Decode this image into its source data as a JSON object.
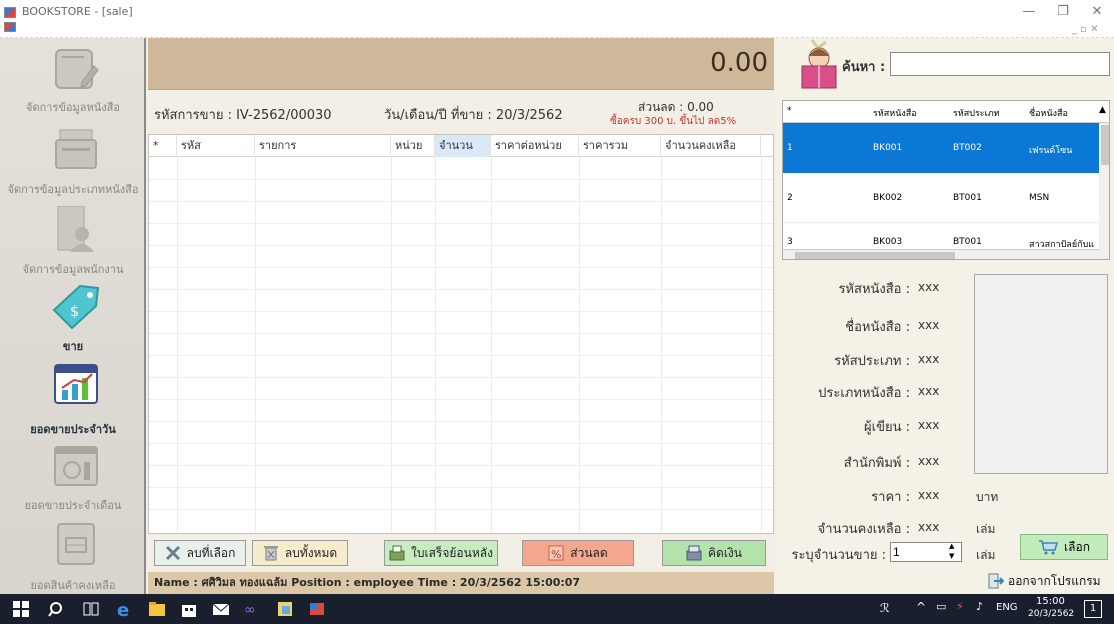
{
  "window": {
    "title": "BOOKSTORE - [sale]",
    "controls": [
      "—",
      "❐",
      "✕"
    ],
    "mdi_controls": "_ ▫ ✕"
  },
  "sidebar": {
    "items": [
      {
        "label": "จัดการข้อมูลหนังสือ",
        "icon": "book-edit-icon",
        "active": false
      },
      {
        "label": "จัดการข้อมูลประเภทหนังสือ",
        "icon": "book-stack-icon",
        "active": false
      },
      {
        "label": "จัดการข้อมูลพนักงาน",
        "icon": "employee-icon",
        "active": false
      },
      {
        "label": "ขาย",
        "icon": "price-tag-icon",
        "active": true
      },
      {
        "label": "ยอดขายประจำวัน",
        "icon": "daily-chart-icon",
        "active": true
      },
      {
        "label": "ยอดขายประจำเดือน",
        "icon": "monthly-money-icon",
        "active": false
      },
      {
        "label": "ยอดสินค้าคงเหลือ",
        "icon": "inventory-icon",
        "active": false
      }
    ]
  },
  "sale": {
    "total": "0.00",
    "sale_id_label": "รหัสการขาย : IV-2562/00030",
    "date_label": "วัน/เดือน/ปี ที่ขาย : 20/3/2562",
    "discount_label": "ส่วนลด : 0.00",
    "discount_note": "ซื้อครบ 300 บ. ขึ้นไป ลด5%",
    "columns": [
      "*",
      "รหัส",
      "รายการ",
      "หน่วย",
      "จำนวน",
      "ราคาต่อหน่วย",
      "ราคารวม",
      "จำนวนคงเหลือ"
    ]
  },
  "buttons": {
    "delete_selected": "ลบที่เลือก",
    "delete_all": "ลบทั้งหมด",
    "receipt_history": "ใบเสร็จย้อนหลัง",
    "discount": "ส่วนลด",
    "checkout": "คิดเงิน"
  },
  "status": {
    "text": "Name : ศศิวิมล ทองแฉล้ม Position : employee Time : 20/3/2562 15:00:07"
  },
  "search": {
    "label": "ค้นหา :",
    "value": ""
  },
  "book_grid": {
    "columns": [
      "*",
      "รหัสหนังสือ",
      "รหัสประเภท",
      "ชื่อหนังสือ"
    ],
    "rows": [
      {
        "n": "1",
        "book_id": "BK001",
        "type_id": "BT002",
        "name": "เฟรนด์โซน",
        "selected": true
      },
      {
        "n": "2",
        "book_id": "BK002",
        "type_id": "BT001",
        "name": "MSN",
        "selected": false
      },
      {
        "n": "3",
        "book_id": "BK003",
        "type_id": "BT001",
        "name": "สาวสกาปัลย์กับแ",
        "selected": false
      }
    ]
  },
  "details": {
    "book_id_label": "รหัสหนังสือ :",
    "book_id": "xxx",
    "book_name_label": "ชื่อหนังสือ :",
    "book_name": "xxx",
    "type_id_label": "รหัสประเภท :",
    "type_id": "xxx",
    "type_name_label": "ประเภทหนังสือ :",
    "type_name": "xxx",
    "author_label": "ผู้เขียน :",
    "author": "xxx",
    "publisher_label": "สำนักพิมพ์ :",
    "publisher": "xxx",
    "price_label": "ราคา :",
    "price": "xxx",
    "price_unit": "บาท",
    "stock_label": "จำนวนคงเหลือ :",
    "stock": "xxx",
    "stock_unit": "เล่ม",
    "qty_label": "ระบุจำนวนขาย :",
    "qty": "1",
    "qty_unit": "เล่ม",
    "select_button": "เลือก",
    "exit_button": "ออกจากโปรแกรม"
  },
  "taskbar": {
    "lang": "ENG",
    "time": "15:00",
    "date": "20/3/2562",
    "notif": "1"
  }
}
